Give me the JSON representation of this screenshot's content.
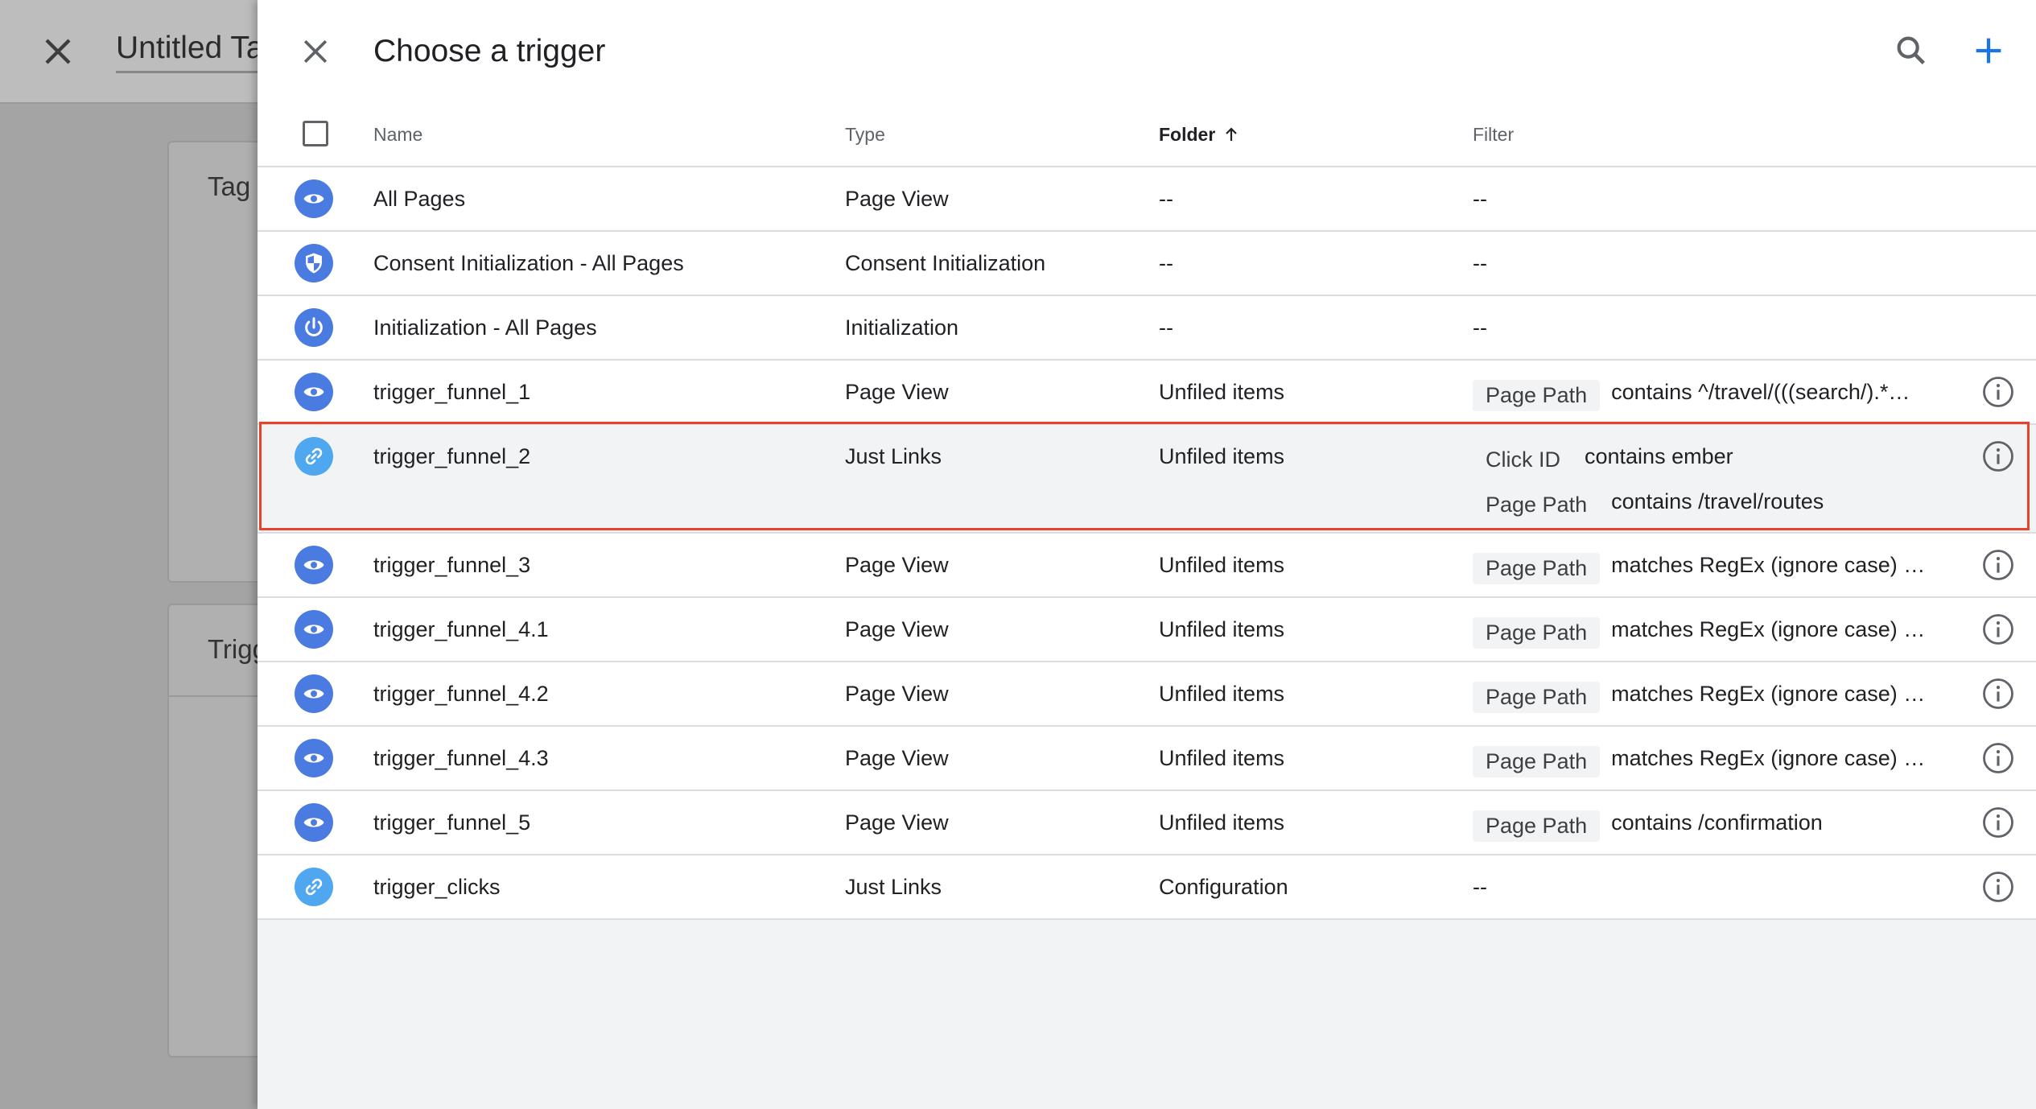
{
  "background": {
    "title": "Untitled Ta",
    "card1_caption": "Tag C",
    "card2_caption": "Trigg"
  },
  "drawer": {
    "title": "Choose a trigger",
    "columns": {
      "name": "Name",
      "type": "Type",
      "folder": "Folder",
      "filter": "Filter"
    },
    "sort": {
      "column": "Folder",
      "direction": "ascending"
    },
    "rows": [
      {
        "name": "All Pages",
        "type": "Page View",
        "folder": "--",
        "icon": "eye-icon",
        "filters": [
          {
            "text": "--"
          }
        ]
      },
      {
        "name": "Consent Initialization - All Pages",
        "type": "Consent Initialization",
        "folder": "--",
        "icon": "shield-icon",
        "filters": [
          {
            "text": "--"
          }
        ]
      },
      {
        "name": "Initialization - All Pages",
        "type": "Initialization",
        "folder": "--",
        "icon": "power-icon",
        "filters": [
          {
            "text": "--"
          }
        ]
      },
      {
        "name": "trigger_funnel_1",
        "type": "Page View",
        "folder": "Unfiled items",
        "icon": "eye-icon",
        "filters": [
          {
            "chip": "Page Path",
            "text": "contains ^/travel/(((search/).*…"
          }
        ]
      },
      {
        "name": "trigger_funnel_2",
        "type": "Just Links",
        "folder": "Unfiled items",
        "icon": "link-icon",
        "highlighted": true,
        "filters": [
          {
            "chip": "Click ID",
            "text": "contains ember"
          },
          {
            "chip": "Page Path",
            "text": "contains /travel/routes"
          }
        ]
      },
      {
        "name": "trigger_funnel_3",
        "type": "Page View",
        "folder": "Unfiled items",
        "icon": "eye-icon",
        "filters": [
          {
            "chip": "Page Path",
            "text": "matches RegEx (ignore case) …"
          }
        ]
      },
      {
        "name": "trigger_funnel_4.1",
        "type": "Page View",
        "folder": "Unfiled items",
        "icon": "eye-icon",
        "filters": [
          {
            "chip": "Page Path",
            "text": "matches RegEx (ignore case) …"
          }
        ]
      },
      {
        "name": "trigger_funnel_4.2",
        "type": "Page View",
        "folder": "Unfiled items",
        "icon": "eye-icon",
        "filters": [
          {
            "chip": "Page Path",
            "text": "matches RegEx (ignore case) …"
          }
        ]
      },
      {
        "name": "trigger_funnel_4.3",
        "type": "Page View",
        "folder": "Unfiled items",
        "icon": "eye-icon",
        "filters": [
          {
            "chip": "Page Path",
            "text": "matches RegEx (ignore case) …"
          }
        ]
      },
      {
        "name": "trigger_funnel_5",
        "type": "Page View",
        "folder": "Unfiled items",
        "icon": "eye-icon",
        "filters": [
          {
            "chip": "Page Path",
            "text": "contains /confirmation"
          }
        ]
      },
      {
        "name": "trigger_clicks",
        "type": "Just Links",
        "folder": "Configuration",
        "icon": "link-icon",
        "filters": [
          {
            "text": "--"
          }
        ]
      }
    ]
  },
  "colors": {
    "accent": "#1a73e8",
    "icon_blue": "#4a7be0",
    "icon_light_blue": "#4fa8ef",
    "highlight": "#e8412c"
  }
}
